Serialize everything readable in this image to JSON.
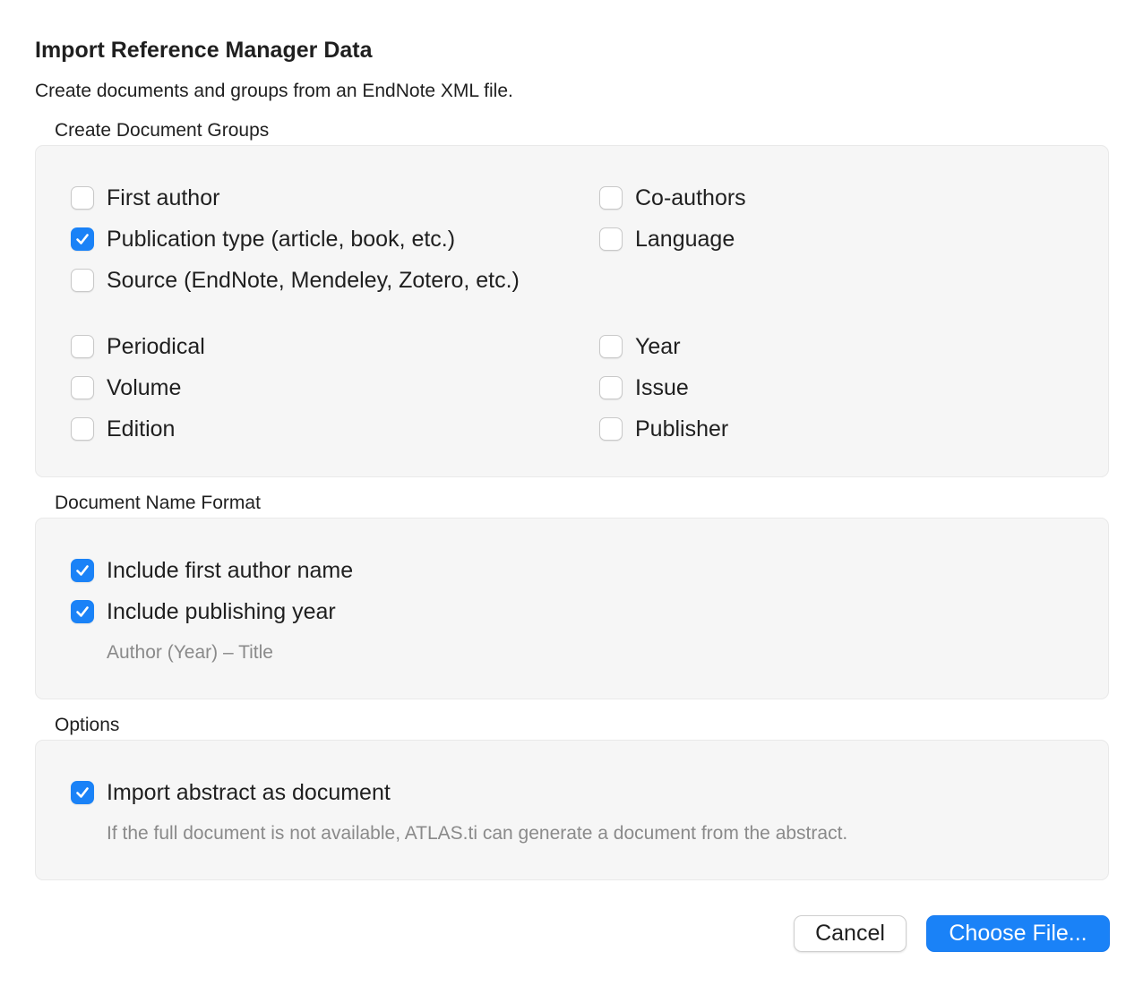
{
  "dialog": {
    "title": "Import Reference Manager Data",
    "subtitle": "Create documents and groups from an EndNote XML file."
  },
  "groups": {
    "label": "Create Document Groups",
    "items": [
      {
        "label": "First author",
        "checked": false
      },
      {
        "label": "Co-authors",
        "checked": false
      },
      {
        "label": "Publication type (article, book, etc.)",
        "checked": true
      },
      {
        "label": "Language",
        "checked": false
      },
      {
        "label": "Source (EndNote, Mendeley, Zotero, etc.)",
        "checked": false
      },
      {
        "label": "Periodical",
        "checked": false
      },
      {
        "label": "Year",
        "checked": false
      },
      {
        "label": "Volume",
        "checked": false
      },
      {
        "label": "Issue",
        "checked": false
      },
      {
        "label": "Edition",
        "checked": false
      },
      {
        "label": "Publisher",
        "checked": false
      }
    ]
  },
  "name_format": {
    "label": "Document Name Format",
    "items": [
      {
        "label": "Include first author name",
        "checked": true
      },
      {
        "label": "Include publishing year",
        "checked": true
      }
    ],
    "preview": "Author (Year) – Title"
  },
  "options": {
    "label": "Options",
    "items": [
      {
        "label": "Import abstract as document",
        "checked": true
      }
    ],
    "hint": "If the full document is not available, ATLAS.ti can generate a document from the abstract."
  },
  "buttons": {
    "cancel": "Cancel",
    "choose": "Choose File..."
  },
  "colors": {
    "accent": "#1a82f7",
    "panel": "#f6f6f6"
  }
}
